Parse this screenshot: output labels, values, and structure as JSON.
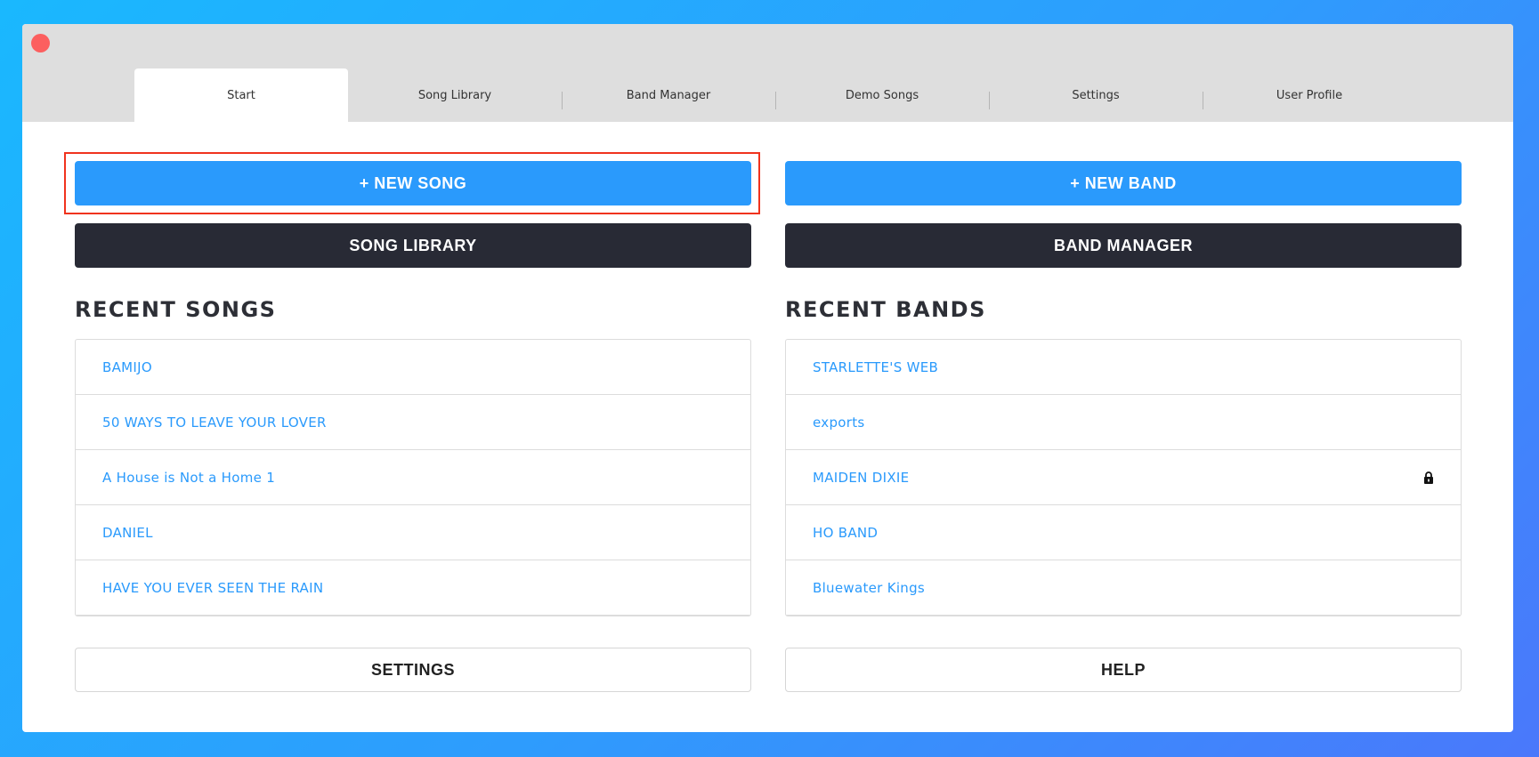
{
  "tabs": [
    {
      "label": "Start",
      "active": true
    },
    {
      "label": "Song Library",
      "active": false
    },
    {
      "label": "Band Manager",
      "active": false
    },
    {
      "label": "Demo Songs",
      "active": false
    },
    {
      "label": "Settings",
      "active": false
    },
    {
      "label": "User Profile",
      "active": false
    }
  ],
  "buttons": {
    "new_song": "+ NEW SONG",
    "new_band": "+ NEW BAND",
    "song_library": "SONG LIBRARY",
    "band_manager": "BAND MANAGER",
    "settings": "SETTINGS",
    "help": "HELP"
  },
  "recent_songs": {
    "title": "RECENT SONGS",
    "items": [
      {
        "label": "BAMIJO"
      },
      {
        "label": "50 WAYS TO LEAVE YOUR LOVER"
      },
      {
        "label": "A House is Not a Home 1"
      },
      {
        "label": "DANIEL"
      },
      {
        "label": "HAVE YOU EVER SEEN THE RAIN"
      }
    ]
  },
  "recent_bands": {
    "title": "RECENT BANDS",
    "items": [
      {
        "label": "STARLETTE'S WEB",
        "locked": false
      },
      {
        "label": "exports",
        "locked": false
      },
      {
        "label": "MAIDEN DIXIE",
        "locked": true,
        "icon": "lock-icon"
      },
      {
        "label": "HO BAND",
        "locked": false
      },
      {
        "label": "Bluewater Kings",
        "locked": false
      }
    ]
  },
  "colors": {
    "accent": "#2a9afc",
    "dark_button": "#282a35",
    "close_button": "#fc5f5f",
    "highlight_border": "#f0331e",
    "titlebar": "#dedede"
  }
}
